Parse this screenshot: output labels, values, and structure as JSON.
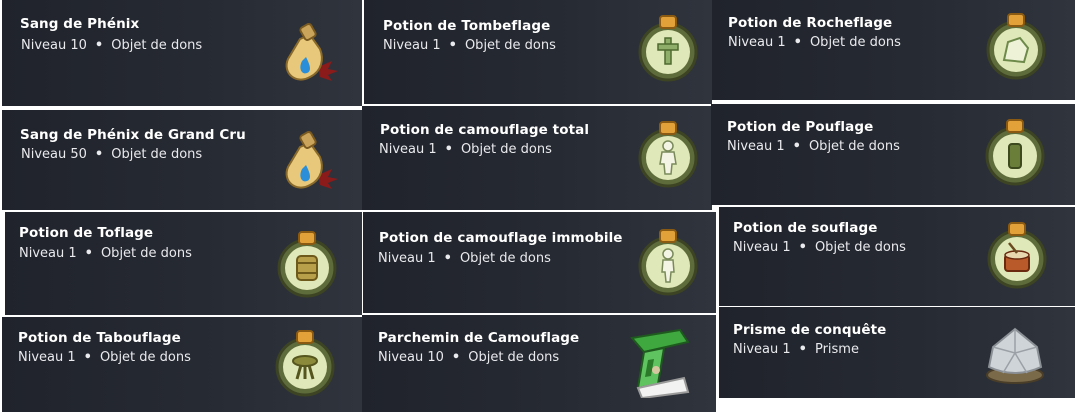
{
  "separator": "•",
  "items": [
    {
      "name": "Sang de Phénix",
      "level": "Niveau 10",
      "category": "Objet de dons",
      "icon": "phoenix-blood-flask-icon"
    },
    {
      "name": "Potion de Tombeflage",
      "level": "Niveau 1",
      "category": "Objet de dons",
      "icon": "tomb-camouflage-potion-icon"
    },
    {
      "name": "Potion de Rocheflage",
      "level": "Niveau 1",
      "category": "Objet de dons",
      "icon": "rock-camouflage-potion-icon"
    },
    {
      "name": "Sang de Phénix de Grand Cru",
      "level": "Niveau 50",
      "category": "Objet de dons",
      "icon": "phoenix-blood-flask-icon"
    },
    {
      "name": "Potion de camouflage total",
      "level": "Niveau 1",
      "category": "Objet de dons",
      "icon": "total-camouflage-potion-icon"
    },
    {
      "name": "Potion de Pouflage",
      "level": "Niveau 1",
      "category": "Objet de dons",
      "icon": "pouflage-potion-icon"
    },
    {
      "name": "Potion de Toflage",
      "level": "Niveau 1",
      "category": "Objet de dons",
      "icon": "barrel-camouflage-potion-icon"
    },
    {
      "name": "Potion de camouflage immobile",
      "level": "Niveau 1",
      "category": "Objet de dons",
      "icon": "still-camouflage-potion-icon"
    },
    {
      "name": "Potion de souflage",
      "level": "Niveau 1",
      "category": "Objet de dons",
      "icon": "drum-camouflage-potion-icon"
    },
    {
      "name": "Potion de Tabouflage",
      "level": "Niveau 1",
      "category": "Objet de dons",
      "icon": "stool-camouflage-potion-icon"
    },
    {
      "name": "Parchemin de Camouflage",
      "level": "Niveau 10",
      "category": "Objet de dons",
      "icon": "camouflage-scroll-icon"
    },
    {
      "name": "Prisme de conquête",
      "level": "Niveau 1",
      "category": "Prisme",
      "icon": "conquest-prism-icon"
    }
  ]
}
